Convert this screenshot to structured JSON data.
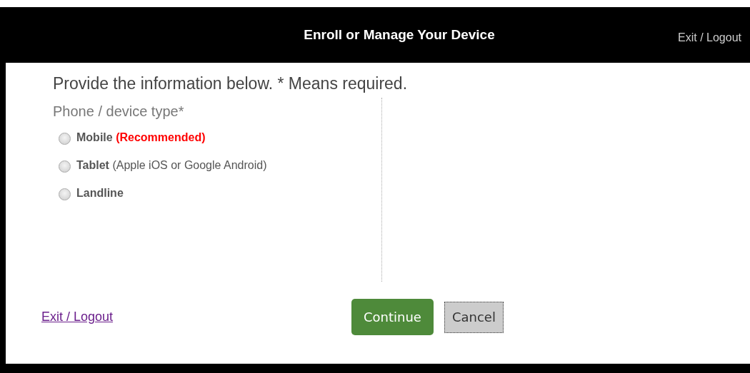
{
  "header": {
    "title": "Enroll or Manage Your Device",
    "exit_link": "Exit / Logout"
  },
  "instructions": "Provide the information below. * Means required.",
  "device_type": {
    "label": "Phone / device type*",
    "options": [
      {
        "label": "Mobile",
        "note": "(Recommended)",
        "kind": "recommended",
        "selected": false
      },
      {
        "label": "Tablet",
        "note": "(Apple iOS or Google Android)",
        "kind": "described",
        "selected": false
      },
      {
        "label": "Landline",
        "selected": false
      }
    ]
  },
  "footer": {
    "exit_link": "Exit / Logout",
    "buttons": [
      {
        "label": "Continue",
        "kind": "primary"
      },
      {
        "label": "Cancel",
        "kind": "secondary"
      }
    ]
  }
}
